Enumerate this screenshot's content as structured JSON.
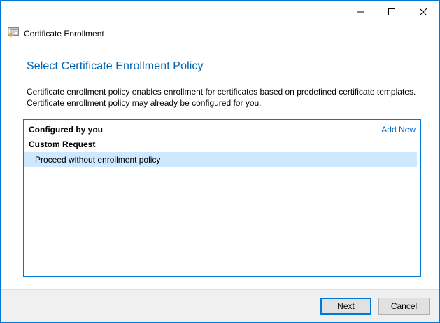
{
  "window": {
    "title": "Certificate Enrollment",
    "controls": {
      "minimize": "minimize",
      "maximize": "maximize",
      "close": "close"
    }
  },
  "header": {
    "icon": "certificate-icon",
    "title": "Certificate Enrollment"
  },
  "main": {
    "heading": "Select Certificate Enrollment Policy",
    "description": {
      "line1": "Certificate enrollment policy enables enrollment for certificates based on predefined certificate templates.",
      "line2": "Certificate enrollment policy may already be configured for you."
    },
    "policy_list": {
      "groups": [
        {
          "label": "Configured by you",
          "action_label": "Add New"
        },
        {
          "label": "Custom Request"
        }
      ],
      "items": [
        {
          "label": "Proceed without enrollment policy",
          "selected": true,
          "group": "Custom Request"
        }
      ]
    }
  },
  "footer": {
    "buttons": [
      {
        "label": "Next",
        "default": true
      },
      {
        "label": "Cancel",
        "default": false
      }
    ]
  },
  "colors": {
    "accent_border": "#0078D7",
    "heading_text": "#0063B1",
    "link_text": "#0066CC",
    "selection_bg": "#CDE8FF",
    "footer_bg": "#F0F0F0",
    "footer_divider": "#DFDFDF",
    "button_bg": "#E1E1E1",
    "button_border": "#ADADAD"
  }
}
